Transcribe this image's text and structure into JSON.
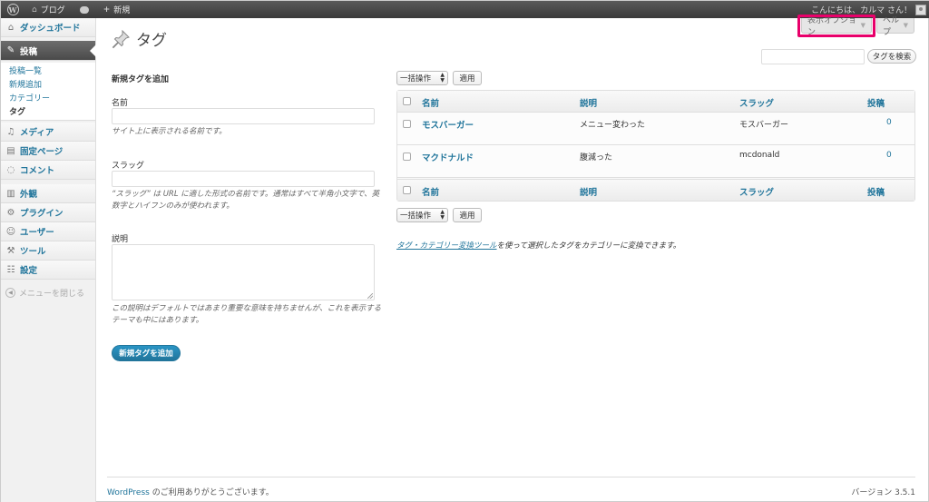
{
  "adminbar": {
    "site_name": "ブログ",
    "new_label": "新規",
    "greeting": "こんにちは、カルマ さん！"
  },
  "sidebar": {
    "items": [
      {
        "label": "ダッシュボード",
        "icon": "home-icon"
      },
      {
        "label": "投稿",
        "icon": "pin-icon"
      },
      {
        "label": "メディア",
        "icon": "media-icon"
      },
      {
        "label": "固定ページ",
        "icon": "page-icon"
      },
      {
        "label": "コメント",
        "icon": "comment-icon"
      },
      {
        "label": "外観",
        "icon": "appearance-icon"
      },
      {
        "label": "プラグイン",
        "icon": "plugin-icon"
      },
      {
        "label": "ユーザー",
        "icon": "users-icon"
      },
      {
        "label": "ツール",
        "icon": "tools-icon"
      },
      {
        "label": "設定",
        "icon": "settings-icon"
      }
    ],
    "submenu": [
      "投稿一覧",
      "新規追加",
      "カテゴリー",
      "タグ"
    ],
    "collapse_label": "メニューを閉じる"
  },
  "screen_options": "表示オプション",
  "help": "ヘルプ",
  "page_title": "タグ",
  "search": {
    "button": "タグを検索",
    "value": ""
  },
  "form": {
    "heading": "新規タグを追加",
    "name_label": "名前",
    "name_hint": "サイト上に表示される名前です。",
    "slug_label": "スラッグ",
    "slug_hint": "“スラッグ” は URL に適した形式の名前です。通常はすべて半角小文字で、英数字とハイフンのみが使われます。",
    "desc_label": "説明",
    "desc_hint": "この説明はデフォルトではあまり重要な意味を持ちませんが、これを表示するテーマも中にはあります。",
    "submit": "新規タグを追加"
  },
  "bulk": {
    "select": "一括操作",
    "apply": "適用"
  },
  "table": {
    "columns": [
      "名前",
      "説明",
      "スラッグ",
      "投稿"
    ],
    "rows": [
      {
        "name": "モスバーガー",
        "description": "メニュー変わった",
        "slug": "モスバーガー",
        "count": "0"
      },
      {
        "name": "マクドナルド",
        "description": "腹減った",
        "slug": "mcdonald",
        "count": "0"
      }
    ]
  },
  "convert": {
    "link": "タグ・カテゴリー変換ツール",
    "text": "を使って選択したタグをカテゴリーに変換できます。"
  },
  "footer": {
    "link": "WordPress",
    "thanks": " のご利用ありがとうございます。",
    "version": "バージョン 3.5.1"
  },
  "colors": {
    "accent": "#21759b",
    "highlight": "#e8006a"
  }
}
